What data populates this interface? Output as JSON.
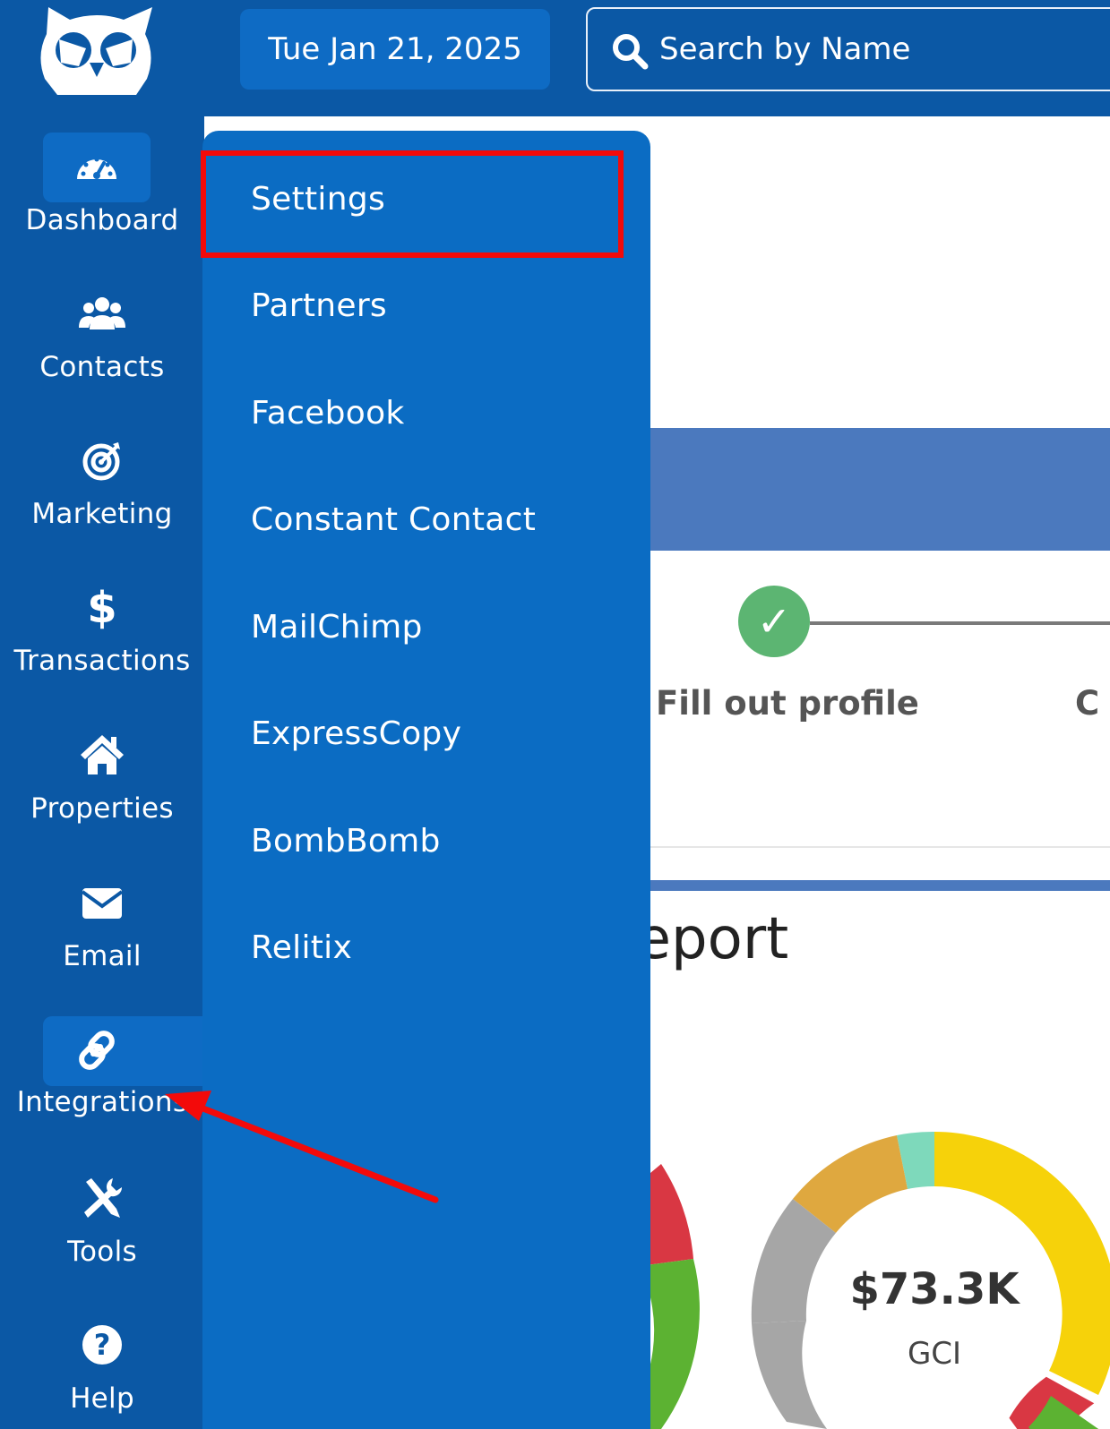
{
  "header": {
    "date_label": "Tue Jan 21, 2025",
    "search": {
      "placeholder": "Search by Name",
      "value": ""
    }
  },
  "sidebar": {
    "items": [
      {
        "label": "Dashboard",
        "icon": "speedometer-icon",
        "active": true
      },
      {
        "label": "Contacts",
        "icon": "users-icon"
      },
      {
        "label": "Marketing",
        "icon": "target-icon"
      },
      {
        "label": "Transactions",
        "icon": "dollar-icon"
      },
      {
        "label": "Properties",
        "icon": "home-icon"
      },
      {
        "label": "Email",
        "icon": "envelope-icon"
      },
      {
        "label": "Integrations",
        "icon": "link-icon",
        "active": true
      },
      {
        "label": "Tools",
        "icon": "tools-icon"
      },
      {
        "label": "Help",
        "icon": "help-icon"
      }
    ]
  },
  "integrations_menu": {
    "items": [
      {
        "label": "Settings",
        "highlighted": true
      },
      {
        "label": "Partners"
      },
      {
        "label": "Facebook"
      },
      {
        "label": "Constant Contact"
      },
      {
        "label": "MailChimp"
      },
      {
        "label": "ExpressCopy"
      },
      {
        "label": "BombBomb"
      },
      {
        "label": "Relitix"
      }
    ]
  },
  "main": {
    "progress": {
      "step_label": "Fill out profile",
      "next_step_partial": "C",
      "step_complete": true
    },
    "report": {
      "title_visible": "on Report",
      "gci_value": "$73.3K",
      "gci_label": "GCI"
    }
  },
  "colors": {
    "sidebar_bg": "#0b58a5",
    "menu_bg": "#0b6cc3",
    "active_item_bg": "#0e6bc4",
    "highlight_box": "#f30a0a",
    "check_green": "#5cb572",
    "band_blue": "#4b79be"
  }
}
